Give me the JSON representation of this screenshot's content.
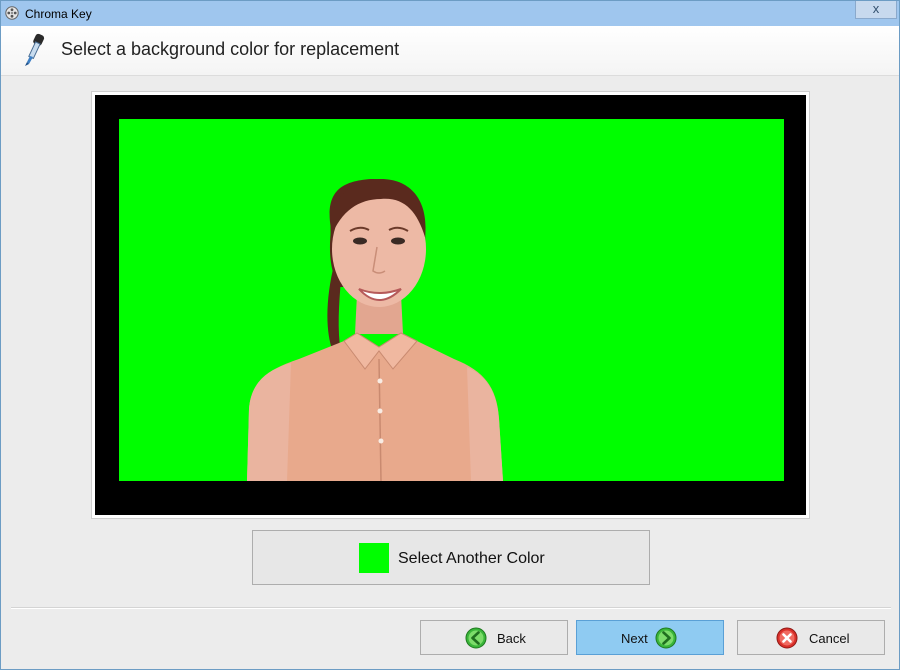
{
  "window": {
    "title": "Chroma Key",
    "close_glyph": "x"
  },
  "header": {
    "title": "Select a background color for replacement",
    "icon": "eyedropper-icon"
  },
  "preview": {
    "description_icon": "chroma-key-preview-image",
    "key_color": "#00fe00"
  },
  "select_color": {
    "label": "Select Another Color",
    "swatch_color": "#00fe00"
  },
  "footer": {
    "back_label": "Back",
    "next_label": "Next",
    "cancel_label": "Cancel",
    "back_icon": "arrow-left-icon",
    "next_icon": "arrow-right-icon",
    "cancel_icon": "cancel-x-icon",
    "accent_color": "#8fcbf2"
  }
}
